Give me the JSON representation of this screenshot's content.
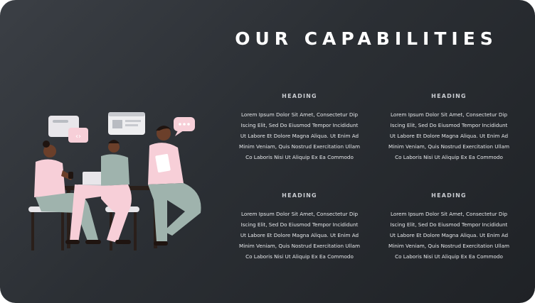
{
  "title": "OUR CAPABILITIES",
  "cards": [
    {
      "heading": "HEADING",
      "body": "Lorem Ipsum Dolor Sit Amet, Consectetur Dip\nIscing Elit, Sed Do Eiusmod Tempor Incididunt\nUt Labore Et Dolore Magna Aliqua. Ut Enim Ad\nMinim Veniam, Quis Nostrud Exercitation Ullam\nCo Laboris Nisi Ut Aliquip Ex Ea Commodo"
    },
    {
      "heading": "HEADING",
      "body": "Lorem Ipsum Dolor Sit Amet, Consectetur Dip\nIscing Elit, Sed Do Eiusmod Tempor Incididunt\nUt Labore Et Dolore Magna Aliqua. Ut Enim Ad\nMinim Veniam, Quis Nostrud Exercitation Ullam\nCo Laboris Nisi Ut Aliquip Ex Ea Commodo"
    },
    {
      "heading": "HEADING",
      "body": "Lorem Ipsum Dolor Sit Amet, Consectetur Dip\nIscing Elit, Sed Do Eiusmod Tempor Incididunt\nUt Labore Et Dolore Magna Aliqua. Ut Enim Ad\nMinim Veniam, Quis Nostrud Exercitation Ullam\nCo Laboris Nisi Ut Aliquip Ex Ea Commodo"
    },
    {
      "heading": "HEADING",
      "body": "Lorem Ipsum Dolor Sit Amet, Consectetur Dip\nIscing Elit, Sed Do Eiusmod Tempor Incididunt\nUt Labore Et Dolore Magna Aliqua. Ut Enim Ad\nMinim Veniam, Quis Nostrud Exercitation Ullam\nCo Laboris Nisi Ut Aliquip Ex Ea Commodo"
    }
  ],
  "colors": {
    "background": "#2b2f34",
    "title": "#ffffff",
    "pink": "#f7cfd8",
    "sage": "#9fb3ad",
    "skin": "#6b3f2a",
    "furniture": "#2a1f1a"
  },
  "illustration": "team-meeting-illustration"
}
